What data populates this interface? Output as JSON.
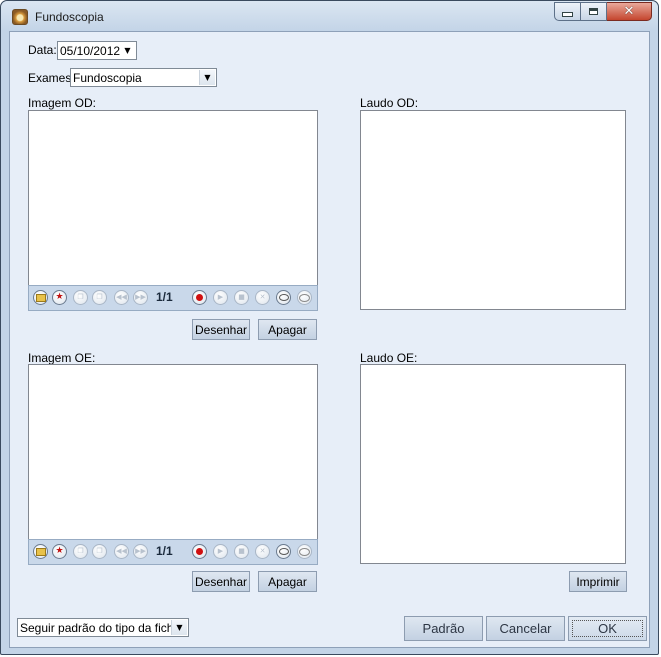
{
  "window": {
    "title": "Fundoscopia",
    "icon": "app-eye-icon",
    "controls": {
      "minimize": "minimize-icon",
      "maximize": "maximize-icon",
      "close": "close-icon"
    }
  },
  "form": {
    "date_label": "Data:",
    "date_value": "05/10/2012",
    "exam_label": "Exames:",
    "exam_value": "Fundoscopia"
  },
  "od": {
    "image_label": "Imagem OD:",
    "report_label": "Laudo OD:",
    "counter": "1/1",
    "draw_button": "Desenhar",
    "erase_button": "Apagar"
  },
  "oe": {
    "image_label": "Imagem OE:",
    "report_label": "Laudo OE:",
    "counter": "1/1",
    "draw_button": "Desenhar",
    "erase_button": "Apagar",
    "print_button": "Imprimir"
  },
  "footer": {
    "template_select": "Seguir padrão do tipo da ficha",
    "default_button": "Padrão",
    "cancel_button": "Cancelar",
    "ok_button": "OK"
  },
  "colors": {
    "window_frame": "#c3d4e7",
    "client_bg": "#e7eef8",
    "toolbar_bg": "#c9d8ea",
    "record_red": "#d01010"
  }
}
